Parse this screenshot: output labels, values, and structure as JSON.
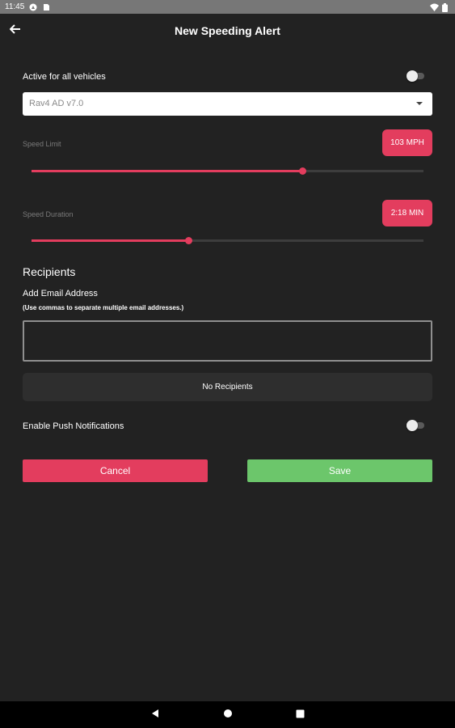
{
  "status_bar": {
    "time": "11:45",
    "icons": [
      "maps-notification-icon",
      "sd-card-icon",
      "wifi-icon",
      "battery-icon"
    ]
  },
  "header": {
    "title": "New Speeding Alert",
    "back_icon": "arrow-left-icon"
  },
  "active_all": {
    "label": "Active for all vehicles",
    "enabled": false
  },
  "vehicle_select": {
    "value": "Rav4 AD v7.0"
  },
  "speed_limit": {
    "label": "Speed Limit",
    "badge": "103 MPH",
    "fraction": 0.69
  },
  "speed_duration": {
    "label": "Speed Duration",
    "badge": "2:18 MIN",
    "fraction": 0.4
  },
  "recipients": {
    "title": "Recipients",
    "add_label": "Add Email Address",
    "hint": "(Use commas to separate multiple email addresses.)",
    "email_value": "",
    "empty_text": "No Recipients"
  },
  "push": {
    "label": "Enable Push Notifications",
    "enabled": false
  },
  "actions": {
    "cancel": "Cancel",
    "save": "Save"
  },
  "colors": {
    "accent": "#e33d5e",
    "save": "#6cc66b",
    "background": "#222222"
  },
  "nav": {
    "icons": [
      "back-triangle-icon",
      "home-circle-icon",
      "recents-square-icon"
    ]
  }
}
